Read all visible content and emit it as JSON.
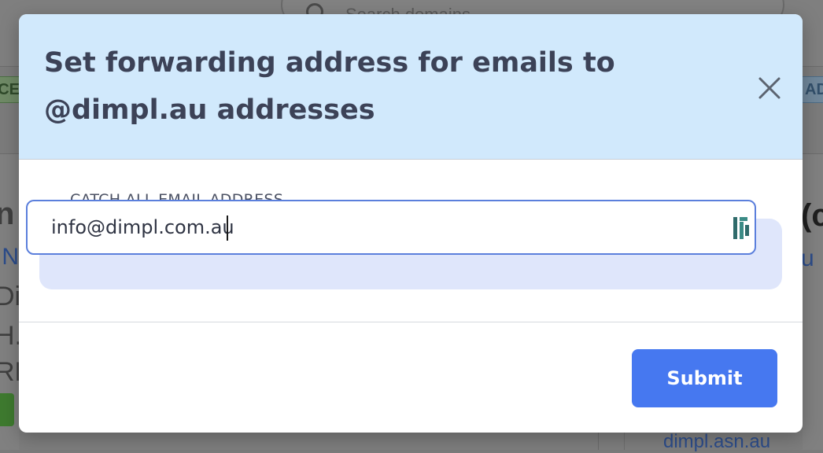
{
  "background": {
    "search_placeholder": "Search domains",
    "tag_left": "CE",
    "tag_right": "AD",
    "left_lines": [
      "n",
      "IN",
      "Di",
      "H.",
      "RE"
    ],
    "right_lines": [
      "(c",
      "u"
    ],
    "bottom_link": "dimpl.asn.au"
  },
  "modal": {
    "title": "Set forwarding address for emails to @dimpl.au addresses",
    "field_label": "CATCH ALL EMAIL ADDRESS",
    "email_value": "info@dimpl.com.au",
    "submit_label": "Submit",
    "close_icon": "close-icon",
    "field_icon": "password-manager-icon"
  },
  "colors": {
    "header_bg": "#d1e9fc",
    "accent": "#4678f0",
    "title_text": "#3c4257"
  }
}
